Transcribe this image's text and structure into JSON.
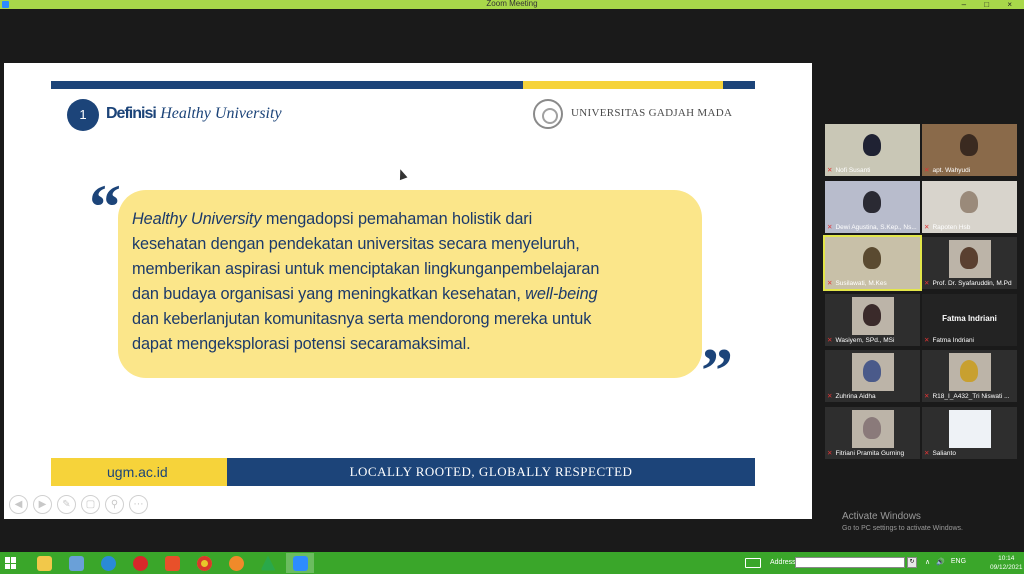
{
  "window": {
    "title": "Zoom Meeting",
    "buttons": [
      "–",
      "□",
      "×"
    ]
  },
  "slide": {
    "number": "1",
    "heading_bold": "Definisi",
    "heading_italic": "Healthy University",
    "university": "UNIVERSITAS GADJAH MADA",
    "quote_open": "“",
    "quote_close": "”",
    "quote_lines": {
      "l1_italic": "Healthy University",
      "l1_rest": " mengadopsi pemahaman holistik dari",
      "l2": "kesehatan dengan pendekatan universitas secara menyeluruh,",
      "l3": "memberikan aspirasi untuk menciptakan lingkunganpembelajaran",
      "l4_start": "dan budaya organisasi yang meningkatkan kesehatan, ",
      "l4_italic": "well-being",
      "l5": "dan keberlanjutan komunitasnya serta mendorong mereka untuk",
      "l6": "dapat mengeksplorasi potensi secaramaksimal."
    },
    "footer_url": "ugm.ac.id",
    "footer_tagline": "LOCALLY ROOTED, GLOBALLY RESPECTED"
  },
  "slide_controls": [
    "◀",
    "▶",
    "✎",
    "▢",
    "⚲",
    "⋯"
  ],
  "participants": [
    {
      "name": "Nofi Susanti",
      "bg": "#c9c7b6",
      "head": "#1f2233"
    },
    {
      "name": "apt. Wahyudi",
      "bg": "#8a6a4a",
      "head": "#3a2a20"
    },
    {
      "name": "Dewi Agustina, S.Kep., Ns...",
      "bg": "#b8bccc",
      "head": "#2a2a33"
    },
    {
      "name": "Rapoten Hsb",
      "bg": "#d8d4cc",
      "head": "#9a8a7a"
    },
    {
      "name": "Susilawati, M.Kes",
      "bg": "#c8c0a8",
      "head": "#5a4a30"
    },
    {
      "name": "Prof. Dr. Syafaruddin, M.Pd",
      "bg": "#2e2e2e",
      "head": "#5a4030"
    },
    {
      "name": "Wasiyem, SPd., MSi",
      "bg": "#2e2e2e",
      "head": "#3a2a2a"
    },
    {
      "name": "Fatma Indriani",
      "bg": "#232323",
      "head": "",
      "center": "Fatma Indriani"
    },
    {
      "name": "Zuhrina Aidha",
      "bg": "#2e2e2e",
      "head": "#4a5a8a"
    },
    {
      "name": "R18_I_A432_Tri Niswati ...",
      "bg": "#2e2e2e",
      "head": "#c8a030"
    },
    {
      "name": "Fitriani Pramita Gurning",
      "bg": "#2e2e2e",
      "head": "#8a7a7a"
    },
    {
      "name": "Salianto",
      "bg": "#2e2e2e",
      "head": ""
    }
  ],
  "activate": {
    "title": "Activate Windows",
    "sub": "Go to PC settings to activate Windows."
  },
  "taskbar": {
    "address_label": "Address",
    "tray": [
      "∧",
      "🔊",
      "ENG"
    ],
    "time": "10:14",
    "date": "09/12/2021"
  },
  "colors": {
    "navy": "#1c4479",
    "yellow": "#f6d33a",
    "bubble": "#fbe68a",
    "taskbar": "#3aa62a"
  }
}
